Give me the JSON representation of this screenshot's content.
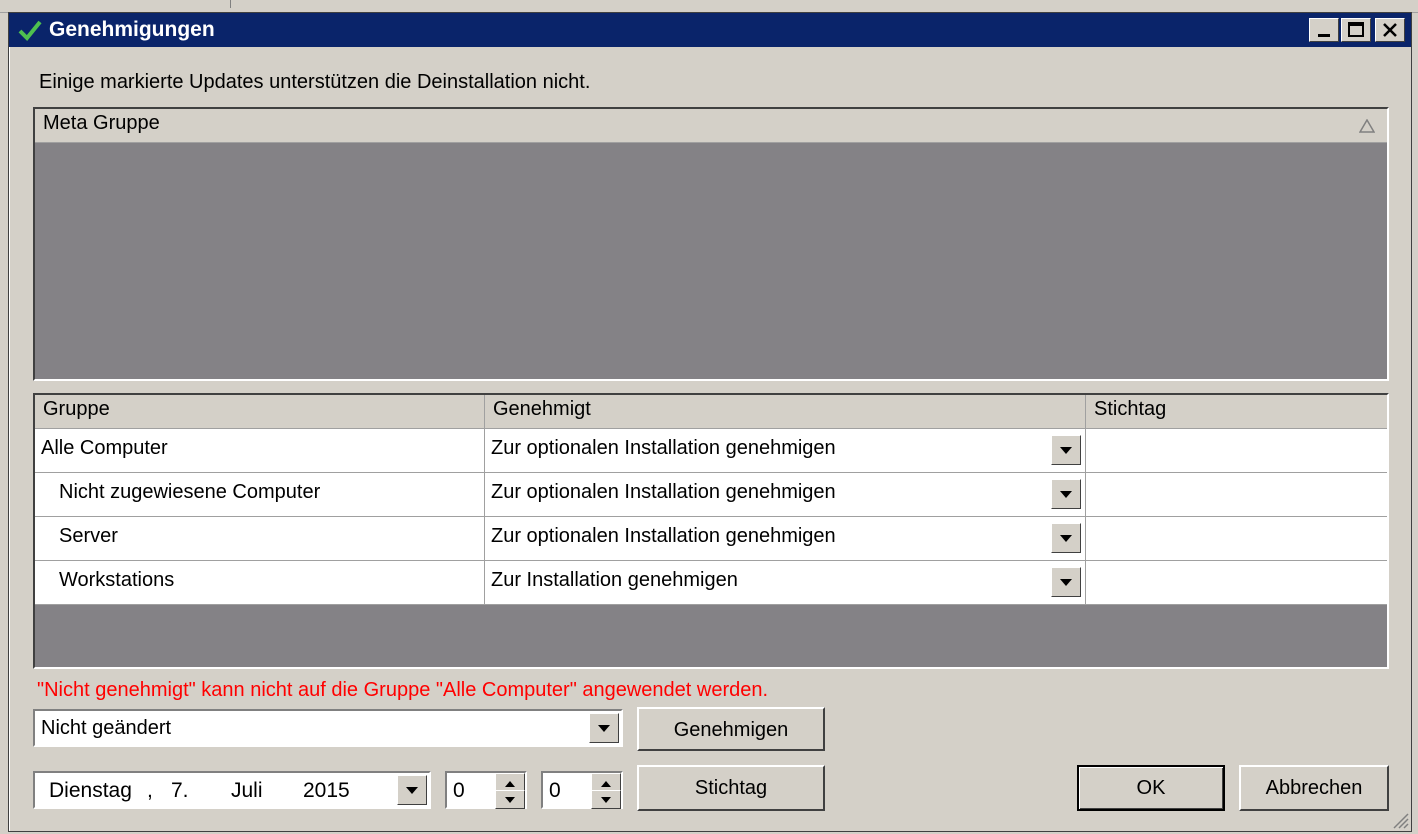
{
  "window": {
    "title": "Genehmigungen",
    "message": "Einige markierte Updates unterstützen die Deinstallation nicht."
  },
  "meta_list": {
    "header": "Meta Gruppe"
  },
  "groups_table": {
    "columns": [
      "Gruppe",
      "Genehmigt",
      "Stichtag"
    ],
    "rows": [
      {
        "group": "Alle Computer",
        "approval": "Zur optionalen Installation genehmigen",
        "deadline": ""
      },
      {
        "group": "Nicht zugewiesene Computer",
        "approval": "Zur optionalen Installation genehmigen",
        "deadline": ""
      },
      {
        "group": "Server",
        "approval": "Zur optionalen Installation genehmigen",
        "deadline": ""
      },
      {
        "group": "Workstations",
        "approval": "Zur Installation genehmigen",
        "deadline": ""
      }
    ]
  },
  "error_text": "\"Nicht genehmigt\" kann nicht auf die Gruppe \"Alle Computer\" angewendet werden.",
  "approval_select": {
    "value": "Nicht geändert"
  },
  "date_picker": {
    "weekday": "Dienstag",
    "sep": ",",
    "day": "7.",
    "month": "Juli",
    "year": "2015"
  },
  "hour_spinner": {
    "value": "0"
  },
  "minute_spinner": {
    "value": "0"
  },
  "buttons": {
    "approve": "Genehmigen",
    "deadline": "Stichtag",
    "ok": "OK",
    "cancel": "Abbrechen"
  },
  "colors": {
    "titlebar": "#0a246a",
    "face": "#d4d0c8",
    "empty_area": "#848286",
    "error": "#ff0000"
  }
}
